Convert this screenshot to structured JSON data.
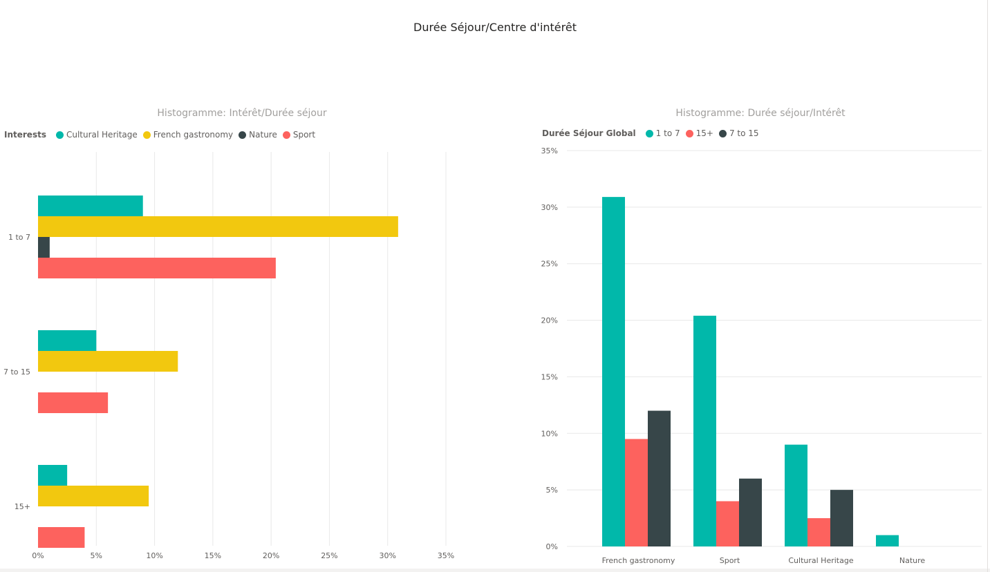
{
  "page": {
    "title": "Durée Séjour/Centre d'intérêt"
  },
  "colors": {
    "teal": "#01b8aa",
    "yellow": "#f2c80f",
    "dark": "#374649",
    "red": "#fd625e"
  },
  "chart_data": [
    {
      "type": "bar",
      "orientation": "horizontal",
      "title": "Histogramme: Intérêt/Durée séjour",
      "legend": {
        "title": "Interests",
        "position": "top-left"
      },
      "categories": [
        "1 to 7",
        "7 to 15",
        "15+"
      ],
      "series": [
        {
          "name": "Cultural Heritage",
          "color": "#01b8aa",
          "values": [
            9.0,
            5.0,
            2.5
          ]
        },
        {
          "name": "French gastronomy",
          "color": "#f2c80f",
          "values": [
            30.9,
            12.0,
            9.5
          ]
        },
        {
          "name": "Nature",
          "color": "#374649",
          "values": [
            1.0,
            0,
            0
          ]
        },
        {
          "name": "Sport",
          "color": "#fd625e",
          "values": [
            20.4,
            6.0,
            4.0
          ]
        }
      ],
      "xlim": [
        0,
        35
      ],
      "xticks": [
        "0%",
        "5%",
        "10%",
        "15%",
        "20%",
        "25%",
        "30%",
        "35%"
      ],
      "grid": true
    },
    {
      "type": "bar",
      "orientation": "vertical",
      "title": "Histogramme: Durée séjour/Intérêt",
      "legend": {
        "title": "Durée Séjour Global",
        "position": "top-left"
      },
      "categories": [
        "French gastronomy",
        "Sport",
        "Cultural Heritage",
        "Nature"
      ],
      "series": [
        {
          "name": "1 to 7",
          "color": "#01b8aa",
          "values": [
            30.9,
            20.4,
            9.0,
            1.0
          ]
        },
        {
          "name": "15+",
          "color": "#fd625e",
          "values": [
            9.5,
            4.0,
            2.5,
            0
          ]
        },
        {
          "name": "7 to 15",
          "color": "#374649",
          "values": [
            12.0,
            6.0,
            5.0,
            0
          ]
        }
      ],
      "ylim": [
        0,
        35
      ],
      "yticks": [
        "0%",
        "5%",
        "10%",
        "15%",
        "20%",
        "25%",
        "30%",
        "35%"
      ],
      "grid": true
    }
  ]
}
